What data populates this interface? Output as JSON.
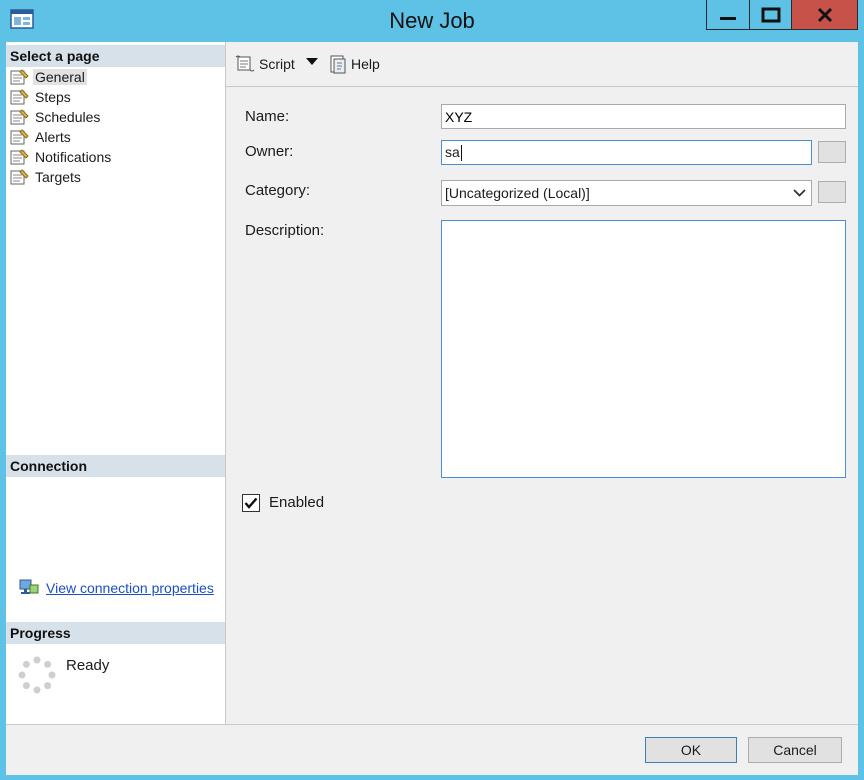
{
  "window": {
    "title": "New Job"
  },
  "titlebar": {
    "minimize_glyph": "—",
    "close_glyph": "X"
  },
  "left_pane": {
    "select_page_header": "Select a page",
    "pages": [
      "General",
      "Steps",
      "Schedules",
      "Alerts",
      "Notifications",
      "Targets"
    ],
    "selected_page": "General",
    "connection_header": "Connection",
    "view_connection_link": "View connection properties",
    "progress_header": "Progress",
    "progress_status": "Ready"
  },
  "toolbar": {
    "script_label": "Script",
    "help_label": "Help"
  },
  "form": {
    "name_label": "Name:",
    "name_value": "XYZ",
    "owner_label": "Owner:",
    "owner_value": "sa",
    "category_label": "Category:",
    "category_value": "[Uncategorized (Local)]",
    "description_label": "Description:",
    "description_value": "",
    "enabled_label": "Enabled",
    "enabled_checked": true
  },
  "footer": {
    "ok_label": "OK",
    "cancel_label": "Cancel"
  },
  "colors": {
    "titlebar": "#5ec2e6",
    "close_button": "#c7524a",
    "section_header": "#d6e1ea",
    "link": "#1a4fc8"
  }
}
